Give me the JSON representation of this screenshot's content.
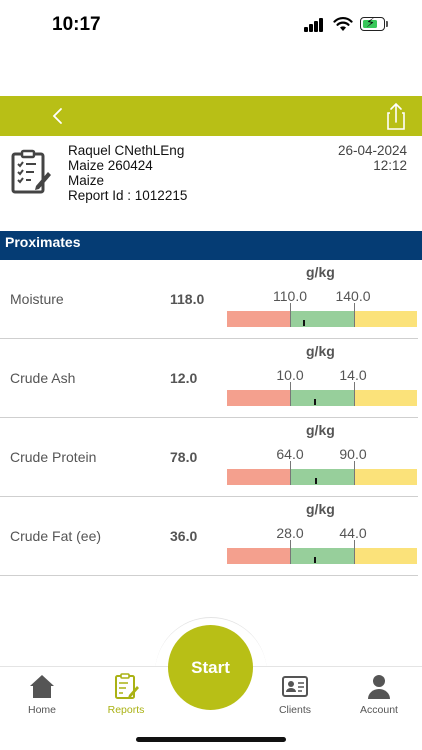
{
  "status_bar": {
    "time": "10:17"
  },
  "header": {
    "name": "Raquel CNethLEng",
    "sample": "Maize 260424",
    "crop": "Maize",
    "report_id": "Report Id : 1012215",
    "date": "26-04-2024",
    "time": "12:12"
  },
  "section": {
    "title": "Proximates"
  },
  "rows": [
    {
      "label": "Moisture",
      "value": "118.0",
      "unit": "g/kg",
      "low": "110.0",
      "high": "140.0",
      "marker_fraction": 0.21
    },
    {
      "label": "Crude Ash",
      "value": "12.0",
      "unit": "g/kg",
      "low": "10.0",
      "high": "14.0",
      "marker_fraction": 0.37
    },
    {
      "label": "Crude Protein",
      "value": "78.0",
      "unit": "g/kg",
      "low": "64.0",
      "high": "90.0",
      "marker_fraction": 0.39
    },
    {
      "label": "Crude Fat (ee)",
      "value": "36.0",
      "unit": "g/kg",
      "low": "28.0",
      "high": "44.0",
      "marker_fraction": 0.37
    }
  ],
  "tabs": {
    "home": "Home",
    "reports": "Reports",
    "start": "Start",
    "clients": "Clients",
    "account": "Account"
  },
  "colors": {
    "brand": "#b8bf16",
    "section": "#053c74",
    "low_zone": "#f4a08e",
    "ok_zone": "#97cf9b",
    "high_zone": "#fbe27a"
  }
}
